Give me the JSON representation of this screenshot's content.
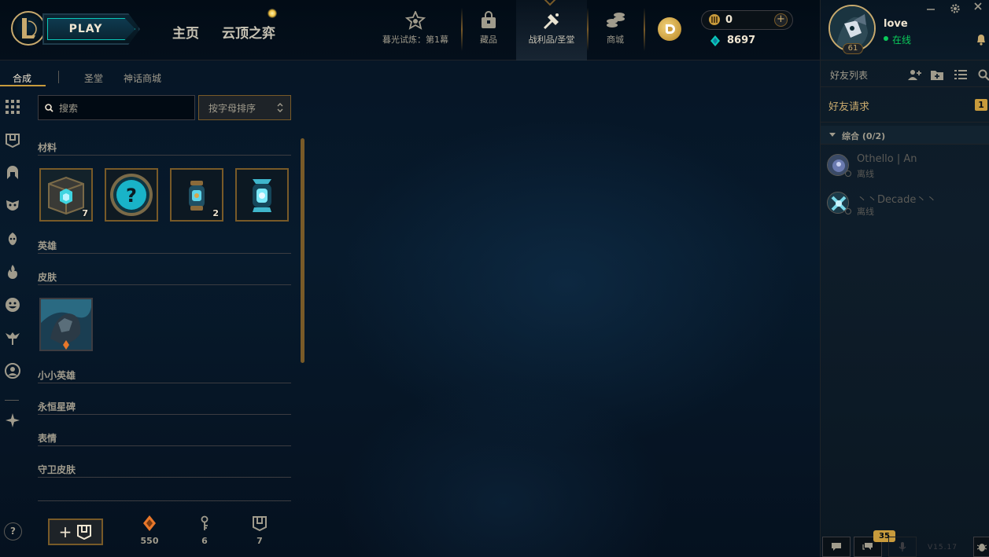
{
  "colors": {
    "gold": "#c8aa6e",
    "gold_dark": "#785a28",
    "teal": "#0ac8b9",
    "online_green": "#0acb5a",
    "text": "#a09b8c",
    "text_bright": "#f0e6d2",
    "badge": "#c89b3c"
  },
  "topnav": {
    "logo_icon": "league-logo-icon",
    "play_label": "PLAY",
    "home_label": "主页",
    "tft_label": "云顶之弈",
    "items": [
      {
        "label": "暮光试炼：第1幕",
        "icon": "event-pass-icon"
      },
      {
        "label": "藏品",
        "icon": "collection-icon"
      },
      {
        "label": "战利品/圣堂",
        "icon": "loot-icon"
      },
      {
        "label": "商城",
        "icon": "store-icon"
      }
    ],
    "active_item": "战利品/圣堂",
    "rp_value": "0",
    "be_value": "8697"
  },
  "profile": {
    "name": "love",
    "status": "在线",
    "level": "61"
  },
  "social": {
    "title": "好友列表",
    "friend_requests_label": "好友请求",
    "friend_requests_count": "1",
    "group_label": "综合 (0/2)",
    "friends": [
      {
        "name": "Othello | An",
        "status": "离线"
      },
      {
        "name": "丶丶Decade丶丶",
        "status": "离线"
      }
    ],
    "chat_badge": "35",
    "version": "V15.17"
  },
  "loot": {
    "tabs": [
      "合成",
      "圣堂",
      "神话商城"
    ],
    "active_tab": "合成",
    "search_placeholder": "搜索",
    "sort_label": "按字母排序",
    "categories": {
      "materials": "材料",
      "champions": "英雄",
      "skins": "皮肤",
      "little_legends": "小小英雄",
      "eternals": "永恒星碑",
      "emotes": "表情",
      "ward_skins": "守卫皮肤"
    },
    "material_items": [
      {
        "icon": "hextech-chest-icon",
        "count": "7"
      },
      {
        "icon": "mystery-orb-icon",
        "count": ""
      },
      {
        "icon": "capsule-icon",
        "count": "2"
      },
      {
        "icon": "masterwork-capsule-icon",
        "count": ""
      }
    ],
    "skin_items": [
      {
        "icon": "skin-shard-icon",
        "count": ""
      }
    ],
    "resources": [
      {
        "icon": "orange-essence-icon",
        "value": "550",
        "color": "#e8772a"
      },
      {
        "icon": "key-icon",
        "value": "6",
        "color": "#a09b8c"
      },
      {
        "icon": "shield-chest-icon",
        "value": "7",
        "color": "#a09b8c"
      }
    ],
    "help_label": "?"
  }
}
